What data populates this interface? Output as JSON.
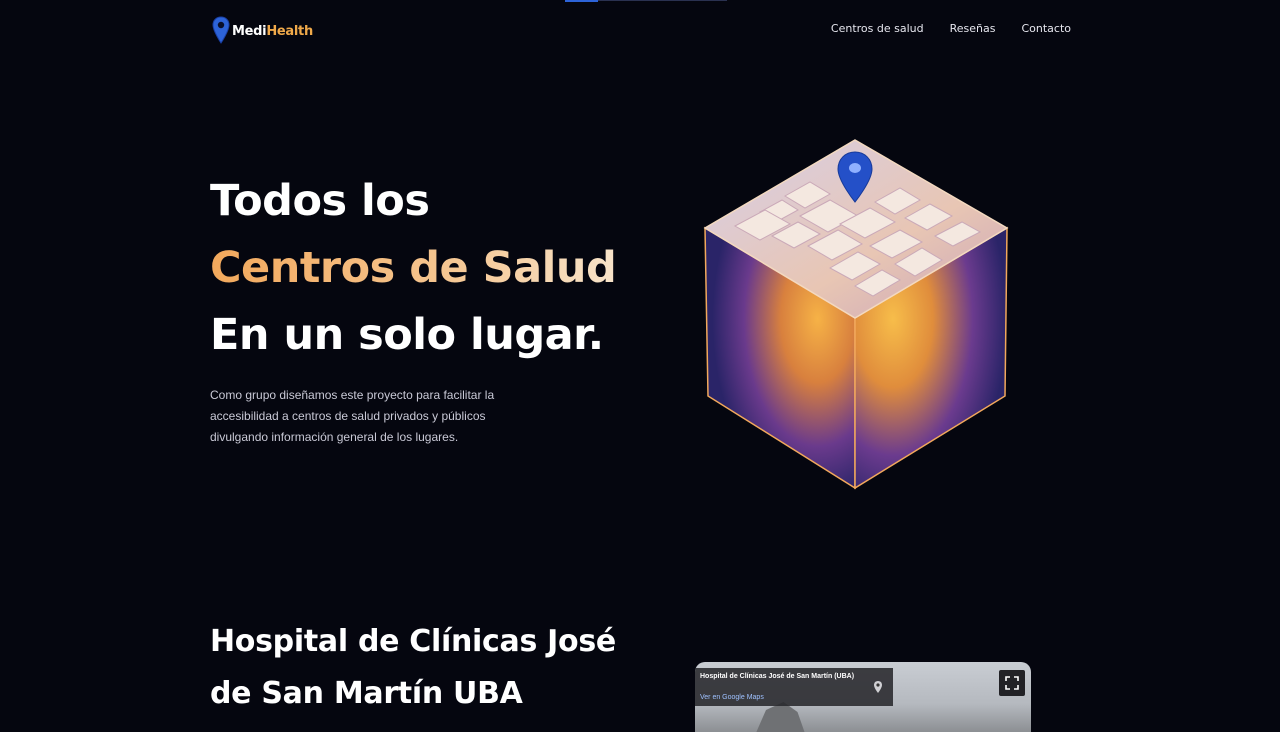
{
  "brand": {
    "name_part1": "Medi",
    "name_part2": "Health"
  },
  "nav": {
    "items": [
      "Centros de salud",
      "Reseñas",
      "Contacto"
    ]
  },
  "hero": {
    "title_line1": "Todos los",
    "title_line2": "Centros de Salud",
    "title_line3": "En un solo lugar.",
    "description": "Como grupo diseñamos este proyecto para facilitar la accesibilidad a centros de salud privados y públicos divulgando información general de los lugares."
  },
  "section": {
    "title": "Hospital de Clínicas José de San Martín UBA"
  },
  "map": {
    "place_title": "Hospital de Clínicas José de San Martín (UBA)",
    "link_text": "Ver en Google Maps"
  },
  "colors": {
    "background": "#05060f",
    "accent": "#f2a85c",
    "brand_blue": "#2d63d8"
  },
  "icons": [
    "map-pin-icon",
    "fullscreen-icon"
  ]
}
